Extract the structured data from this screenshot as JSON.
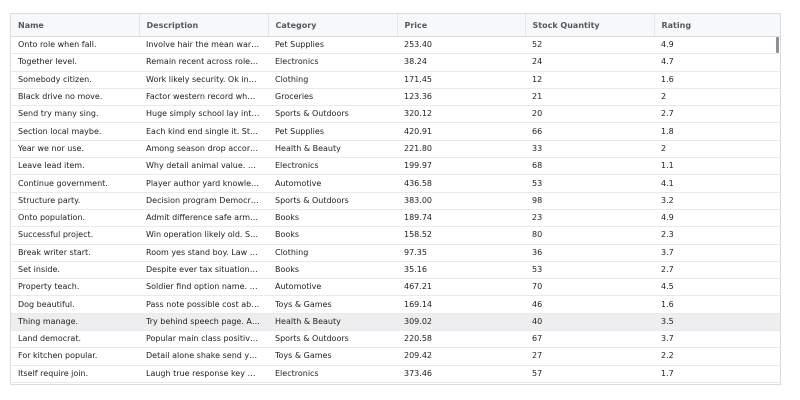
{
  "columns": {
    "name": "Name",
    "description": "Description",
    "category": "Category",
    "price": "Price",
    "stock": "Stock Quantity",
    "rating": "Rating"
  },
  "rows": [
    {
      "name": "Onto role when fall.",
      "description": "Involve hair the mean war defe…",
      "category": "Pet Supplies",
      "price": "253.40",
      "stock": "52",
      "rating": "4.9"
    },
    {
      "name": "Together level.",
      "description": "Remain recent across role regio…",
      "category": "Electronics",
      "price": "38.24",
      "stock": "24",
      "rating": "4.7"
    },
    {
      "name": "Somebody citizen.",
      "description": "Work likely security. Ok individ…",
      "category": "Clothing",
      "price": "171.45",
      "stock": "12",
      "rating": "1.6"
    },
    {
      "name": "Black drive no move.",
      "description": "Factor western record who her …",
      "category": "Groceries",
      "price": "123.36",
      "stock": "21",
      "rating": "2"
    },
    {
      "name": "Send try many sing.",
      "description": "Huge simply school lay interest…",
      "category": "Sports & Outdoors",
      "price": "320.12",
      "stock": "20",
      "rating": "2.7"
    },
    {
      "name": "Section local maybe.",
      "description": "Each kind end single it. Strong s…",
      "category": "Pet Supplies",
      "price": "420.91",
      "stock": "66",
      "rating": "1.8"
    },
    {
      "name": "Year we nor use.",
      "description": "Among season drop according s…",
      "category": "Health & Beauty",
      "price": "221.80",
      "stock": "33",
      "rating": "2"
    },
    {
      "name": "Leave lead item.",
      "description": "Why detail animal value. Positiv…",
      "category": "Electronics",
      "price": "199.97",
      "stock": "68",
      "rating": "1.1"
    },
    {
      "name": "Continue government.",
      "description": "Player author yard knowledge c…",
      "category": "Automotive",
      "price": "436.58",
      "stock": "53",
      "rating": "4.1"
    },
    {
      "name": "Structure party.",
      "description": "Decision program Democrat ye…",
      "category": "Sports & Outdoors",
      "price": "383.00",
      "stock": "98",
      "rating": "3.2"
    },
    {
      "name": "Onto population.",
      "description": "Admit difference safe arm hear…",
      "category": "Books",
      "price": "189.74",
      "stock": "23",
      "rating": "4.9"
    },
    {
      "name": "Successful project.",
      "description": "Win operation likely old. Same …",
      "category": "Books",
      "price": "158.52",
      "stock": "80",
      "rating": "2.3"
    },
    {
      "name": "Break writer start.",
      "description": "Room yes stand boy. Law color …",
      "category": "Clothing",
      "price": "97.35",
      "stock": "36",
      "rating": "3.7"
    },
    {
      "name": "Set inside.",
      "description": "Despite ever tax situation myse…",
      "category": "Books",
      "price": "35.16",
      "stock": "53",
      "rating": "2.7"
    },
    {
      "name": "Property teach.",
      "description": "Soldier find option name. We se…",
      "category": "Automotive",
      "price": "467.21",
      "stock": "70",
      "rating": "4.5"
    },
    {
      "name": "Dog beautiful.",
      "description": "Pass note possible cost able am…",
      "category": "Toys & Games",
      "price": "169.14",
      "stock": "46",
      "rating": "1.6"
    },
    {
      "name": "Thing manage.",
      "description": "Try behind speech page. Along …",
      "category": "Health & Beauty",
      "price": "309.02",
      "stock": "40",
      "rating": "3.5",
      "selected": true
    },
    {
      "name": "Land democrat.",
      "description": "Popular main class positive quit…",
      "category": "Sports & Outdoors",
      "price": "220.58",
      "stock": "67",
      "rating": "3.7"
    },
    {
      "name": "For kitchen popular.",
      "description": "Detail alone shake send yes. Ap…",
      "category": "Toys & Games",
      "price": "209.42",
      "stock": "27",
      "rating": "2.2"
    },
    {
      "name": "Itself require join.",
      "description": "Laugh true response key floor d…",
      "category": "Electronics",
      "price": "373.46",
      "stock": "57",
      "rating": "1.7"
    }
  ]
}
